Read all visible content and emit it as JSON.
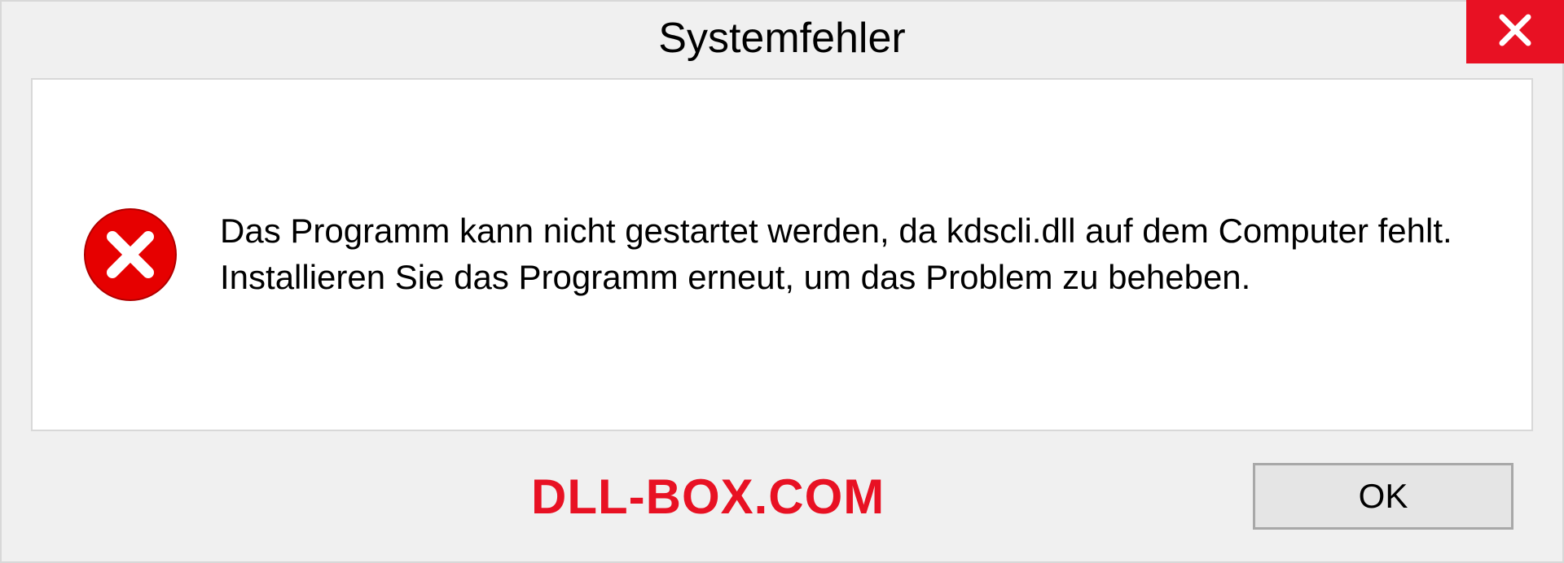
{
  "dialog": {
    "title": "Systemfehler",
    "message": "Das Programm kann nicht gestartet werden, da kdscli.dll auf dem Computer fehlt. Installieren Sie das Programm erneut, um das Problem zu beheben.",
    "ok_label": "OK"
  },
  "watermark": "DLL-BOX.COM"
}
